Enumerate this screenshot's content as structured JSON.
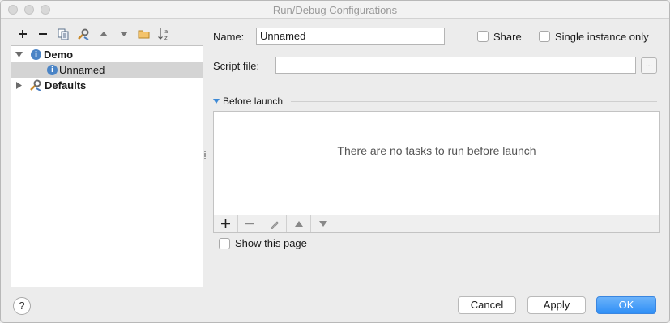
{
  "window": {
    "title": "Run/Debug Configurations"
  },
  "toolbar": {
    "icons": [
      "plus-icon",
      "minus-icon",
      "copy-icon",
      "wrench-icon",
      "move-up-icon",
      "move-down-icon",
      "folder-icon",
      "sort-az-icon"
    ]
  },
  "tree": {
    "items": [
      {
        "label": "Demo",
        "expanded": true,
        "bold": true
      },
      {
        "label": "Unnamed",
        "selected": true
      },
      {
        "label": "Defaults",
        "expanded": false,
        "bold": true
      }
    ]
  },
  "form": {
    "name_label": "Name:",
    "name_value": "Unnamed",
    "share_label": "Share",
    "share_checked": false,
    "single_instance_label": "Single instance only",
    "single_instance_checked": false,
    "script_file_label": "Script file:",
    "script_file_value": "",
    "browse_label": "..."
  },
  "before_launch": {
    "title": "Before launch",
    "empty_text": "There are no tasks to run before launch",
    "show_page_label": "Show this page",
    "show_page_checked": false
  },
  "buttons": {
    "cancel": "Cancel",
    "apply": "Apply",
    "ok": "OK",
    "help": "?"
  },
  "colors": {
    "accent": "#2f8ff6",
    "selection": "#d4d4d4",
    "info_icon": "#4a84c6"
  }
}
